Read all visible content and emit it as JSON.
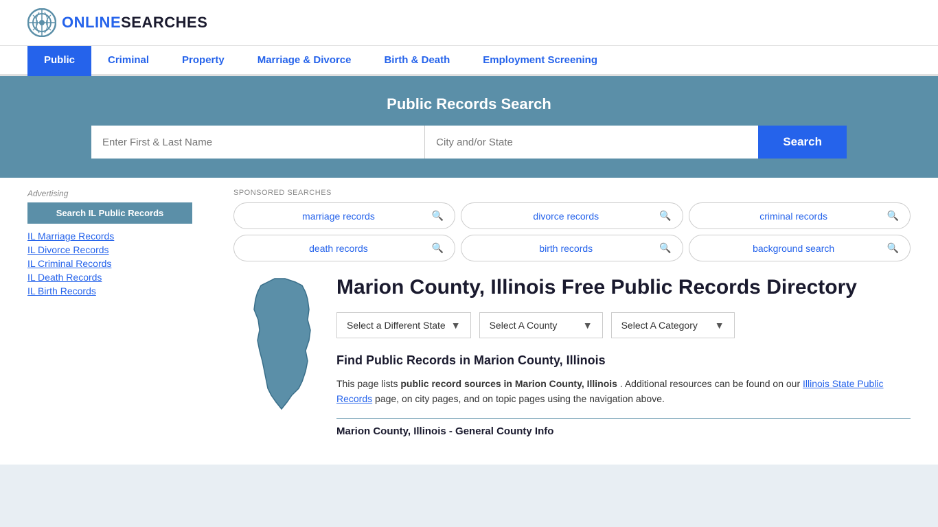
{
  "header": {
    "logo_text_online": "ONLINE",
    "logo_text_searches": "SEARCHES"
  },
  "nav": {
    "items": [
      {
        "label": "Public",
        "active": true
      },
      {
        "label": "Criminal",
        "active": false
      },
      {
        "label": "Property",
        "active": false
      },
      {
        "label": "Marriage & Divorce",
        "active": false
      },
      {
        "label": "Birth & Death",
        "active": false
      },
      {
        "label": "Employment Screening",
        "active": false
      }
    ]
  },
  "search_banner": {
    "title": "Public Records Search",
    "name_placeholder": "Enter First & Last Name",
    "location_placeholder": "City and/or State",
    "search_button": "Search"
  },
  "sponsored": {
    "label": "SPONSORED SEARCHES",
    "pills": [
      {
        "label": "marriage records"
      },
      {
        "label": "divorce records"
      },
      {
        "label": "criminal records"
      },
      {
        "label": "death records"
      },
      {
        "label": "birth records"
      },
      {
        "label": "background search"
      }
    ]
  },
  "county": {
    "title": "Marion County, Illinois Free Public Records Directory",
    "dropdowns": {
      "state": "Select a Different State",
      "county": "Select A County",
      "category": "Select A Category"
    },
    "find_records_title": "Find Public Records in Marion County, Illinois",
    "find_records_intro": "This page lists",
    "find_records_bold": "public record sources in Marion County, Illinois",
    "find_records_mid": ". Additional resources can be found on our",
    "find_records_link": "Illinois State Public Records",
    "find_records_end": "page, on city pages, and on topic pages using the navigation above.",
    "general_info_title": "Marion County, Illinois - General County Info"
  },
  "sidebar": {
    "ad_label": "Advertising",
    "ad_button": "Search IL Public Records",
    "links": [
      {
        "label": "IL Marriage Records"
      },
      {
        "label": "IL Divorce Records"
      },
      {
        "label": "IL Criminal Records"
      },
      {
        "label": "IL Death Records"
      },
      {
        "label": "IL Birth Records"
      }
    ]
  }
}
